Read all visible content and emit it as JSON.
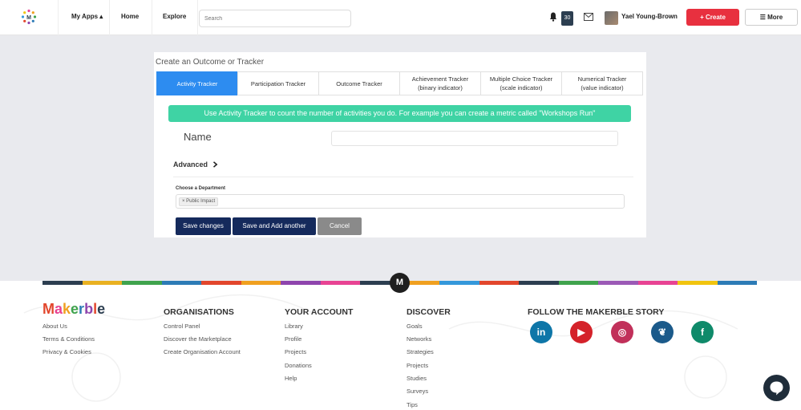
{
  "nav": {
    "my_apps": "My Apps ▴",
    "home": "Home",
    "explore": "Explore",
    "search_placeholder": "Search",
    "notification_count": "30",
    "username": "Yael Young-Brown",
    "create_label": "+ Create",
    "more_label": "☰ More"
  },
  "card": {
    "title": "Create an Outcome or Tracker",
    "tabs": [
      {
        "line1": "Activity Tracker",
        "line2": "",
        "active": true
      },
      {
        "line1": "Participation Tracker",
        "line2": ""
      },
      {
        "line1": "Outcome Tracker",
        "line2": ""
      },
      {
        "line1": "Achievement Tracker",
        "line2": "(binary indicator)"
      },
      {
        "line1": "Multiple Choice Tracker",
        "line2": "(scale indicator)"
      },
      {
        "line1": "Numerical Tracker",
        "line2": "(value indicator)"
      }
    ],
    "info": "Use Activity Tracker to count the number of activities you do. For example you can create a metric called \"Workshops Run\"",
    "name_label": "Name",
    "advanced_label": "Advanced",
    "department_label": "Choose a Department",
    "department_tag": "× Public Impact",
    "save_label": "Save changes",
    "save_add_label": "Save and Add another",
    "cancel_label": "Cancel"
  },
  "footer": {
    "m_label": "M",
    "brand": "Makerble",
    "left_links": [
      "About Us",
      "Terms & Conditions",
      "Privacy & Cookies"
    ],
    "organisations": {
      "head": "ORGANISATIONS",
      "links": [
        "Control Panel",
        "Discover the Marketplace",
        "Create Organisation Account"
      ]
    },
    "account": {
      "head": "YOUR ACCOUNT",
      "links": [
        "Library",
        "Profile",
        "Projects",
        "Donations",
        "Help"
      ]
    },
    "discover": {
      "head": "DISCOVER",
      "links": [
        "Goals",
        "Networks",
        "Strategies",
        "Projects",
        "Studies",
        "Surveys",
        "Tips"
      ]
    },
    "follow_head": "FOLLOW THE MAKERBLE STORY",
    "social": [
      {
        "name": "linkedin",
        "glyph": "in",
        "color": "#0e76a8"
      },
      {
        "name": "youtube",
        "glyph": "▶",
        "color": "#d4222a"
      },
      {
        "name": "instagram",
        "glyph": "◎",
        "color": "#c1305a"
      },
      {
        "name": "twitter",
        "glyph": "❦",
        "color": "#1b5a8a"
      },
      {
        "name": "facebook",
        "glyph": "f",
        "color": "#0f8a6a"
      }
    ]
  },
  "colors": {
    "stripe": [
      "#2c3e50",
      "#e9b121",
      "#3fa34d",
      "#2c7bb6",
      "#e2462c",
      "#f0a020",
      "#8e44ad",
      "#e84393",
      "#2c3e50",
      "#f0a020",
      "#3498db",
      "#e2462c",
      "#2c3e50",
      "#3fa34d",
      "#9b59b6",
      "#e84393",
      "#f1c40f",
      "#2c7bb6"
    ]
  }
}
